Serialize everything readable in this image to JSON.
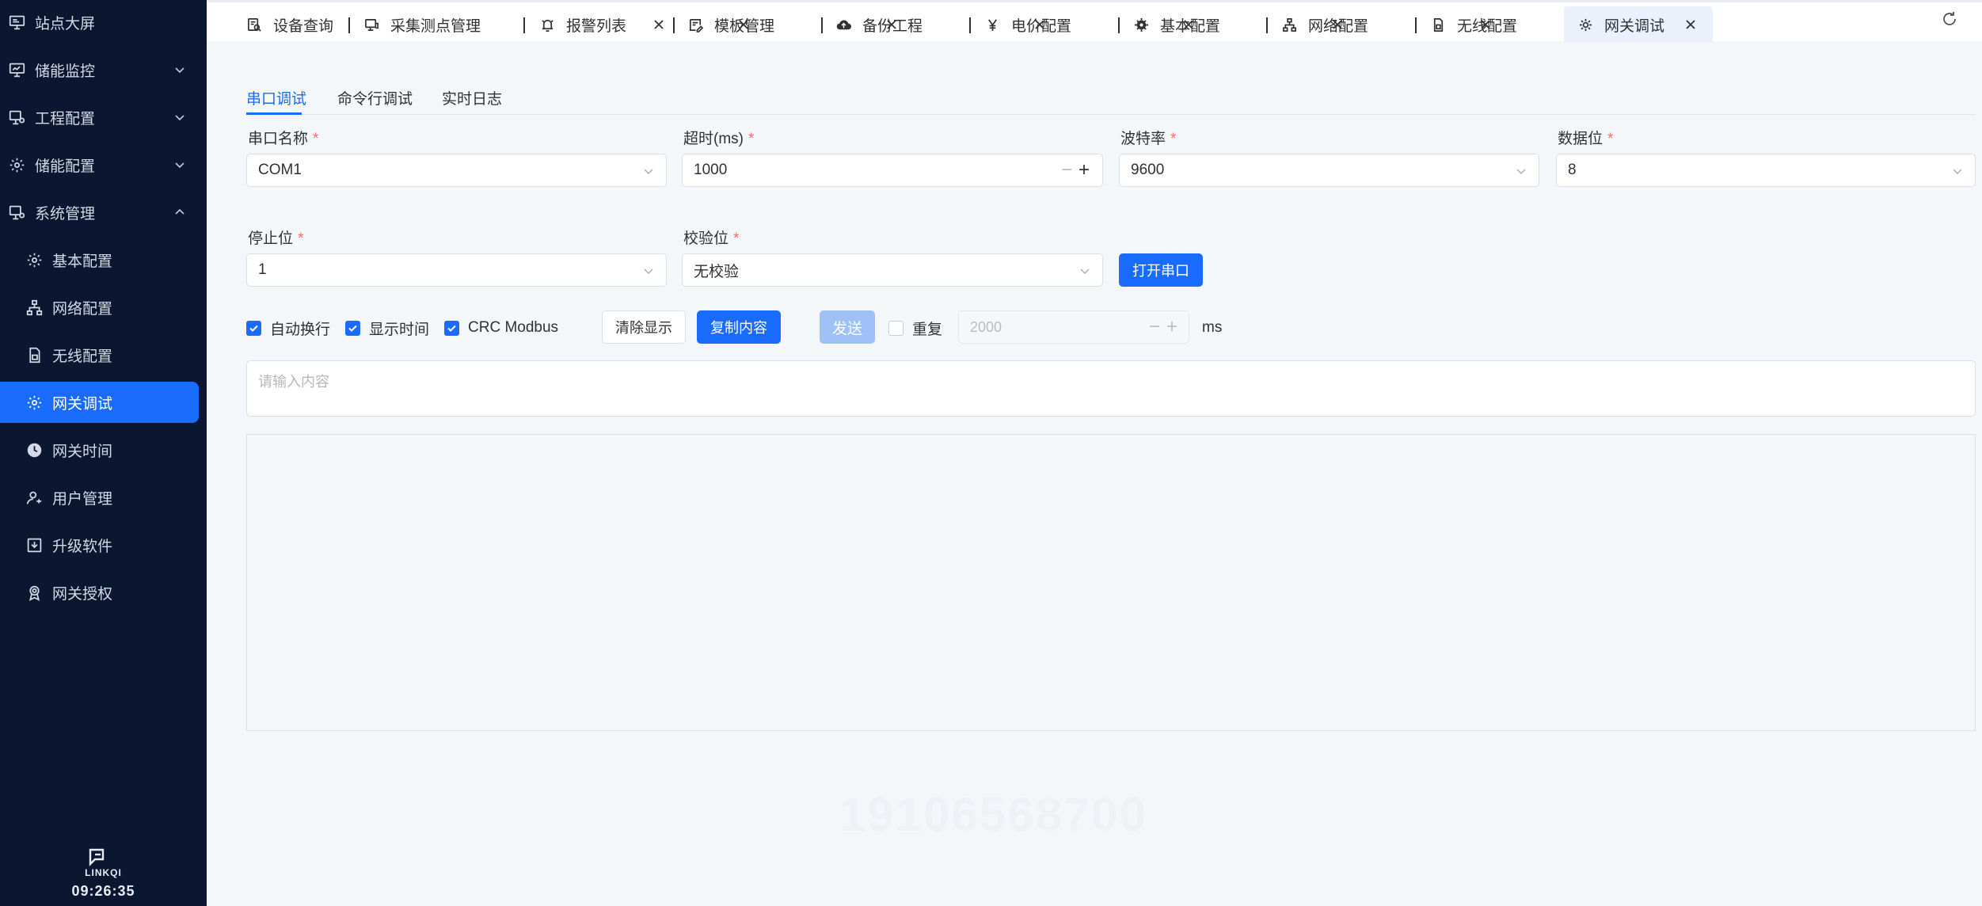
{
  "sidebar": {
    "items": [
      {
        "label": "站点大屏",
        "icon": "monitor-icon"
      },
      {
        "label": "储能监控",
        "icon": "monitor-chart-icon"
      },
      {
        "label": "工程配置",
        "icon": "project-config-icon"
      },
      {
        "label": "储能配置",
        "icon": "gear-icon"
      },
      {
        "label": "系统管理",
        "icon": "system-icon"
      },
      {
        "label": "基本配置",
        "icon": "gear-icon"
      },
      {
        "label": "网络配置",
        "icon": "network-icon"
      },
      {
        "label": "无线配置",
        "icon": "sim-card-icon"
      },
      {
        "label": "网关调试",
        "icon": "debug-gear-icon"
      },
      {
        "label": "网关时间",
        "icon": "clock-icon"
      },
      {
        "label": "用户管理",
        "icon": "user-icon"
      },
      {
        "label": "升级软件",
        "icon": "upgrade-icon"
      },
      {
        "label": "网关授权",
        "icon": "license-icon"
      }
    ],
    "active": "网关调试",
    "footer": {
      "logo_text": "LINKQI",
      "time": "09:26:35"
    }
  },
  "tabs": [
    {
      "label": "设备查询",
      "icon": "device-search-icon",
      "closable": false
    },
    {
      "label": "采集测点管理",
      "icon": "collection-icon",
      "closable": true
    },
    {
      "label": "报警列表",
      "icon": "alarm-icon",
      "closable": true
    },
    {
      "label": "模板管理",
      "icon": "template-icon",
      "closable": true
    },
    {
      "label": "备份工程",
      "icon": "cloud-upload-icon",
      "closable": true
    },
    {
      "label": "电价配置",
      "icon": "yen-icon",
      "closable": true
    },
    {
      "label": "基本配置",
      "icon": "gear-icon",
      "closable": true
    },
    {
      "label": "网络配置",
      "icon": "network-icon",
      "closable": true
    },
    {
      "label": "无线配置",
      "icon": "sim-card-icon",
      "closable": true
    },
    {
      "label": "网关调试",
      "icon": "debug-gear-icon",
      "closable": true,
      "active": true
    }
  ],
  "subtabs": {
    "serial": "串口调试",
    "cmdline": "命令行调试",
    "log": "实时日志",
    "active": "串口调试"
  },
  "form": {
    "port_name": {
      "label": "串口名称",
      "value": "COM1"
    },
    "timeout": {
      "label": "超时(ms)",
      "value": "1000"
    },
    "baud": {
      "label": "波特率",
      "value": "9600"
    },
    "data_bits": {
      "label": "数据位",
      "value": "8"
    },
    "stop_bits": {
      "label": "停止位",
      "value": "1"
    },
    "parity": {
      "label": "校验位",
      "value": "无校验"
    },
    "required_mark": "*",
    "open_button": "打开串口"
  },
  "options": {
    "auto_newline": {
      "label": "自动换行",
      "checked": true
    },
    "show_time": {
      "label": "显示时间",
      "checked": true
    },
    "crc": {
      "label": "CRC Modbus",
      "checked": true
    },
    "clear_button": "清除显示",
    "copy_button": "复制内容",
    "send_button": "发送",
    "repeat": {
      "label": "重复",
      "checked": false
    },
    "interval_placeholder": "2000",
    "unit": "ms"
  },
  "send_input": {
    "placeholder": "请输入内容",
    "value": ""
  },
  "watermark": "19106568700",
  "colors": {
    "primary": "#1a6bff",
    "sidebar_bg": "#0b1730",
    "danger": "#f56c6c"
  }
}
